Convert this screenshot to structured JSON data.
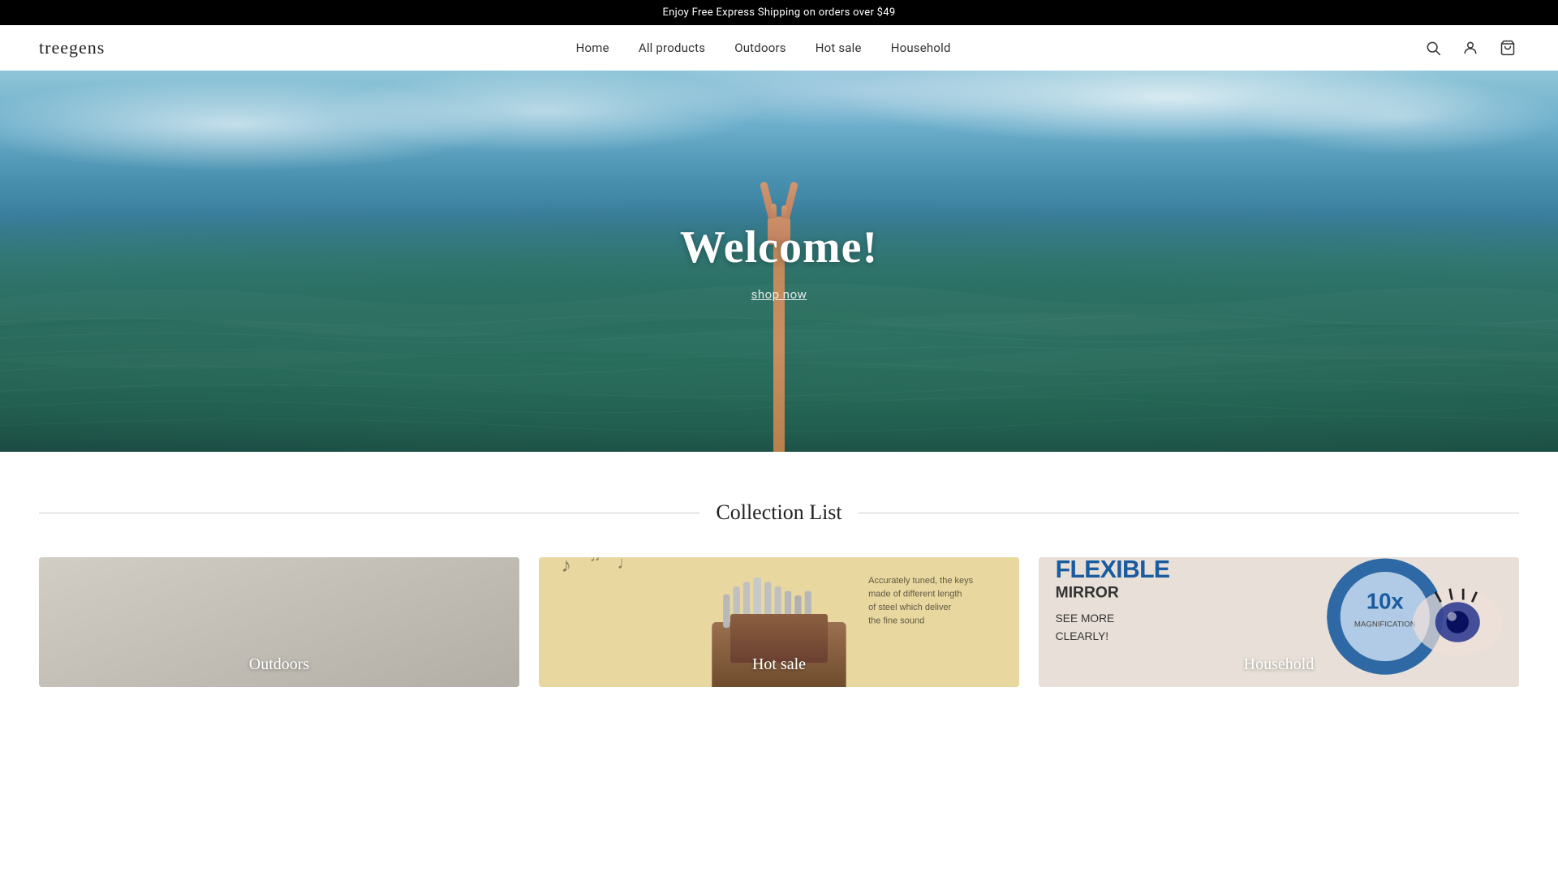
{
  "announcement": {
    "text": "Enjoy Free Express Shipping on orders over $49"
  },
  "header": {
    "logo": "treegens",
    "nav": [
      {
        "label": "Home",
        "key": "home"
      },
      {
        "label": "All products",
        "key": "all-products"
      },
      {
        "label": "Outdoors",
        "key": "outdoors"
      },
      {
        "label": "Hot sale",
        "key": "hot-sale"
      },
      {
        "label": "Household",
        "key": "household"
      }
    ],
    "icons": [
      "search",
      "account",
      "cart"
    ]
  },
  "hero": {
    "title": "Welcome!",
    "cta": "shop now"
  },
  "collection": {
    "title": "Collection List",
    "items": [
      {
        "label": "Outdoors",
        "key": "outdoors"
      },
      {
        "label": "Hot sale",
        "key": "hot-sale"
      },
      {
        "label": "Household",
        "key": "household"
      }
    ]
  }
}
